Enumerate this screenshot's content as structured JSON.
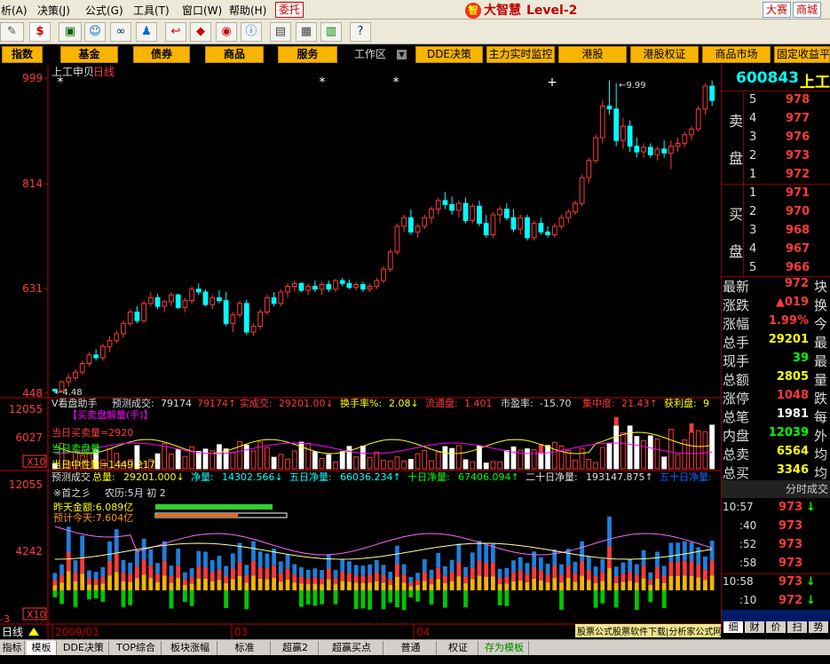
{
  "menu": [
    "析(A)",
    "决策(J)",
    "公式(G)",
    "工具(T)",
    "窗口(W)",
    "帮助(H)"
  ],
  "menu_trade": "委托",
  "brand": {
    "name": "大智慧",
    "level": "Level-2"
  },
  "nav": [
    "指数",
    "基金",
    "债券",
    "商品",
    "服务",
    "DDE决策",
    "主力实时监控",
    "港股",
    "港股权证",
    "商品市场",
    "固定收益平",
    "工作区"
  ],
  "chart_header": {
    "stock": "上工申贝",
    "period": "日线"
  },
  "price_axis": [
    {
      "label": "999",
      "value": 999
    },
    {
      "label": "814",
      "value": 814
    },
    {
      "label": "631",
      "value": 631
    },
    {
      "label": "448",
      "value": 448
    }
  ],
  "price_annot": {
    "high": "9.99",
    "low": "4.48"
  },
  "panel1": {
    "axis": [
      "12055",
      "6027",
      "X10"
    ],
    "title": "V看盘助手",
    "items": [
      {
        "label": "预测成交:",
        "value": "79174"
      },
      {
        "label": "",
        "value": "79174↑"
      },
      {
        "label": "实成交:",
        "value": "29201.00↓"
      },
      {
        "label": "换手率%:",
        "value": "2.08↓"
      },
      {
        "label": "流通盘:",
        "value": "1.401"
      },
      {
        "label": "市盈率:",
        "value": "-15.70"
      },
      {
        "label": "集中度:",
        "value": "21.43↑"
      },
      {
        "label": "获利盘:",
        "value": "9"
      }
    ],
    "sub": "【买卖盘解量(手)】",
    "lines": [
      "当日买卖量=2920",
      "当日卖盘量",
      "当日中性量=1449.217"
    ]
  },
  "panel2": {
    "axis": [
      "12055",
      "4242",
      "X10",
      "3"
    ],
    "items": [
      {
        "label": "预测成交",
        "value": ""
      },
      {
        "label": "总量:",
        "value": "29201.000↓"
      },
      {
        "label": "净量:",
        "value": "14302.566↓"
      },
      {
        "label": "五日净量:",
        "value": "66036.234↑"
      },
      {
        "label": "十日净量:",
        "value": "67406.094↑"
      },
      {
        "label": "二十日净量:",
        "value": "193147.875↑"
      },
      {
        "label": "五十日净量:",
        "value": ""
      }
    ],
    "info": [
      "※首之彡",
      "农历:5月 初 2"
    ],
    "yesterday": "昨天金额:6.089亿",
    "forecast": "预计今天:7.604亿",
    "watermark": "股票公式股票软件下载|分析家公式网www.88gs.com"
  },
  "time_axis": [
    "2009/01",
    "03",
    "04"
  ],
  "period_label": "日线",
  "chart_data": {
    "type": "candlestick",
    "title": "上工申贝 日线",
    "ylim": [
      448,
      999
    ],
    "ohlc": [
      [
        455,
        455,
        448,
        452
      ],
      [
        452,
        470,
        450,
        468
      ],
      [
        468,
        482,
        460,
        475
      ],
      [
        475,
        490,
        470,
        485
      ],
      [
        485,
        505,
        480,
        500
      ],
      [
        500,
        520,
        495,
        515
      ],
      [
        515,
        525,
        505,
        510
      ],
      [
        510,
        535,
        505,
        530
      ],
      [
        530,
        548,
        520,
        540
      ],
      [
        540,
        558,
        535,
        552
      ],
      [
        552,
        575,
        545,
        570
      ],
      [
        570,
        595,
        565,
        590
      ],
      [
        590,
        600,
        570,
        575
      ],
      [
        575,
        610,
        570,
        605
      ],
      [
        605,
        625,
        600,
        615
      ],
      [
        615,
        622,
        595,
        600
      ],
      [
        600,
        612,
        590,
        608
      ],
      [
        608,
        625,
        600,
        620
      ],
      [
        620,
        622,
        595,
        598
      ],
      [
        598,
        615,
        590,
        610
      ],
      [
        610,
        635,
        605,
        630
      ],
      [
        630,
        640,
        620,
        625
      ],
      [
        625,
        630,
        600,
        603
      ],
      [
        603,
        620,
        595,
        615
      ],
      [
        615,
        628,
        605,
        610
      ],
      [
        610,
        625,
        565,
        570
      ],
      [
        570,
        590,
        555,
        585
      ],
      [
        585,
        610,
        580,
        605
      ],
      [
        605,
        612,
        550,
        555
      ],
      [
        555,
        570,
        548,
        565
      ],
      [
        565,
        595,
        560,
        590
      ],
      [
        590,
        620,
        585,
        615
      ],
      [
        615,
        625,
        600,
        605
      ],
      [
        605,
        630,
        600,
        625
      ],
      [
        625,
        640,
        615,
        635
      ],
      [
        635,
        645,
        625,
        640
      ],
      [
        640,
        642,
        625,
        628
      ],
      [
        628,
        640,
        620,
        635
      ],
      [
        635,
        645,
        625,
        630
      ],
      [
        630,
        643,
        620,
        638
      ],
      [
        638,
        645,
        625,
        630
      ],
      [
        630,
        648,
        625,
        645
      ],
      [
        645,
        650,
        635,
        640
      ],
      [
        640,
        647,
        630,
        633
      ],
      [
        633,
        642,
        628,
        638
      ],
      [
        638,
        643,
        625,
        630
      ],
      [
        630,
        640,
        625,
        635
      ],
      [
        635,
        650,
        630,
        645
      ],
      [
        645,
        670,
        640,
        665
      ],
      [
        665,
        700,
        660,
        695
      ],
      [
        695,
        745,
        690,
        740
      ],
      [
        740,
        760,
        730,
        755
      ],
      [
        755,
        770,
        725,
        730
      ],
      [
        730,
        745,
        720,
        740
      ],
      [
        740,
        760,
        735,
        755
      ],
      [
        755,
        775,
        745,
        770
      ],
      [
        770,
        790,
        760,
        785
      ],
      [
        785,
        800,
        770,
        778
      ],
      [
        778,
        792,
        760,
        768
      ],
      [
        768,
        785,
        755,
        780
      ],
      [
        780,
        790,
        745,
        750
      ],
      [
        750,
        780,
        745,
        775
      ],
      [
        775,
        785,
        740,
        745
      ],
      [
        745,
        760,
        720,
        725
      ],
      [
        725,
        765,
        720,
        760
      ],
      [
        760,
        775,
        745,
        770
      ],
      [
        770,
        780,
        750,
        755
      ],
      [
        755,
        770,
        730,
        735
      ],
      [
        735,
        760,
        725,
        755
      ],
      [
        755,
        760,
        715,
        720
      ],
      [
        720,
        750,
        715,
        745
      ],
      [
        745,
        755,
        725,
        730
      ],
      [
        730,
        740,
        720,
        725
      ],
      [
        725,
        745,
        720,
        740
      ],
      [
        740,
        760,
        735,
        755
      ],
      [
        755,
        770,
        745,
        765
      ],
      [
        765,
        785,
        760,
        780
      ],
      [
        780,
        830,
        775,
        825
      ],
      [
        825,
        860,
        815,
        855
      ],
      [
        855,
        900,
        850,
        895
      ],
      [
        895,
        960,
        885,
        950
      ],
      [
        950,
        995,
        935,
        945
      ],
      [
        945,
        990,
        880,
        890
      ],
      [
        890,
        930,
        875,
        915
      ],
      [
        915,
        925,
        870,
        880
      ],
      [
        880,
        895,
        860,
        870
      ],
      [
        870,
        885,
        860,
        878
      ],
      [
        878,
        885,
        860,
        865
      ],
      [
        865,
        880,
        855,
        875
      ],
      [
        875,
        890,
        860,
        868
      ],
      [
        868,
        890,
        840,
        880
      ],
      [
        880,
        895,
        870,
        885
      ],
      [
        885,
        905,
        878,
        900
      ],
      [
        900,
        915,
        890,
        910
      ],
      [
        910,
        950,
        905,
        945
      ],
      [
        945,
        990,
        935,
        985
      ],
      [
        985,
        995,
        950,
        960
      ]
    ],
    "annotations": [
      "9.99",
      "4.48"
    ]
  },
  "quote": {
    "code": "600843",
    "name": "上工",
    "sell_label": [
      "卖",
      "盘"
    ],
    "buy_label": [
      "买",
      "盘"
    ],
    "sell": [
      {
        "n": "5",
        "p": "978"
      },
      {
        "n": "4",
        "p": "977"
      },
      {
        "n": "3",
        "p": "976"
      },
      {
        "n": "2",
        "p": "973"
      },
      {
        "n": "1",
        "p": "972"
      }
    ],
    "buy": [
      {
        "n": "1",
        "p": "971"
      },
      {
        "n": "2",
        "p": "970"
      },
      {
        "n": "3",
        "p": "968"
      },
      {
        "n": "4",
        "p": "967"
      },
      {
        "n": "5",
        "p": "966"
      }
    ],
    "stats": [
      {
        "k": "最新",
        "v": "972",
        "c": "#ff3a3a",
        "t": "块"
      },
      {
        "k": "涨跌",
        "v": "▲019",
        "c": "#ff3a3a",
        "t": "换"
      },
      {
        "k": "涨幅",
        "v": "1.99%",
        "c": "#ff3a3a",
        "t": "今"
      },
      {
        "k": "总手",
        "v": "29201",
        "c": "#ffff00",
        "t": "最"
      },
      {
        "k": "现手",
        "v": "39",
        "c": "#00ff00",
        "t": "最"
      },
      {
        "k": "总额",
        "v": "2805",
        "c": "#ffff00",
        "t": "量"
      },
      {
        "k": "涨停",
        "v": "1048",
        "c": "#ff3a3a",
        "t": "跌"
      },
      {
        "k": "总笔",
        "v": "1981",
        "c": "#ffffff",
        "t": "每"
      },
      {
        "k": "内盘",
        "v": "12039",
        "c": "#00ff00",
        "t": "外"
      },
      {
        "k": "总卖",
        "v": "6564",
        "c": "#ffff00",
        "t": "均"
      },
      {
        "k": "总买",
        "v": "3346",
        "c": "#ffff00",
        "t": "均"
      }
    ]
  },
  "ticks": {
    "header": "分时成交",
    "rows": [
      {
        "t": "10:57",
        "p": "973",
        "a": "↓"
      },
      {
        "t": ":40",
        "p": "973",
        "a": ""
      },
      {
        "t": ":52",
        "p": "973",
        "a": ""
      },
      {
        "t": ":58",
        "p": "973",
        "a": ""
      },
      {
        "t": "10:58",
        "p": "973",
        "a": "↓"
      },
      {
        "t": ":10",
        "p": "972",
        "a": "↓"
      },
      {
        "t": ":40",
        "p": "972",
        "a": ""
      }
    ]
  },
  "bottom_tabs": [
    "指标",
    "模板",
    "DDE决策",
    "TOP综合",
    "板块涨幅",
    "标准",
    "超赢2",
    "超赢买点",
    "普通",
    "权证",
    "存为模板"
  ],
  "right_tabs": [
    "细",
    "财",
    "价",
    "扫",
    "势"
  ],
  "colors": {
    "up": "#ff3a3a",
    "down": "#00ffff",
    "bg": "#000000",
    "axis": "#c00000",
    "gold": "#f7b500"
  }
}
